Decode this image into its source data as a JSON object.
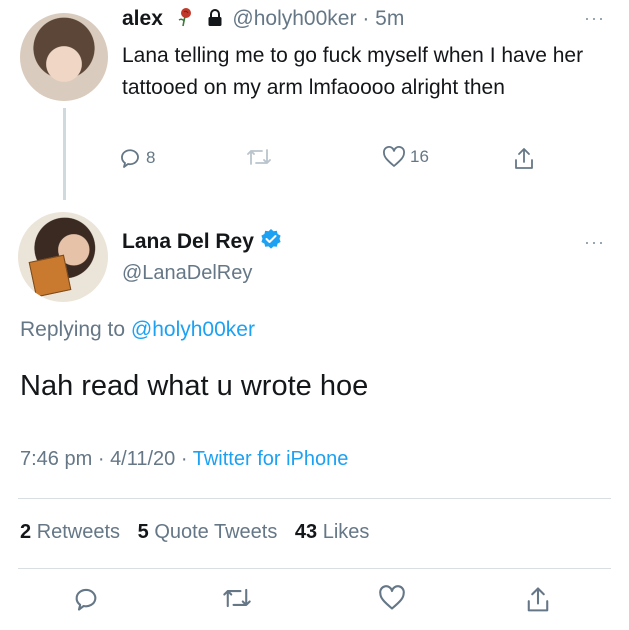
{
  "reply_tweet": {
    "name": "alex",
    "handle": "@holyh00ker",
    "separator": "·",
    "time": "5m",
    "text": "Lana telling me to go fuck myself when I have her tattooed on my arm lmfaoooo alright then",
    "reply_count": "8",
    "like_count": "16",
    "more": "···",
    "icons": [
      "rose-icon",
      "lock-icon",
      "reply-icon",
      "retweet-icon",
      "like-icon",
      "share-icon"
    ]
  },
  "main_tweet": {
    "name": "Lana Del Rey",
    "handle": "@LanaDelRey",
    "more": "···",
    "replying_label": "Replying to",
    "replying_handle": "@holyh00ker",
    "text": "Nah read what u wrote hoe",
    "time": "7:46 pm",
    "sep1": "·",
    "date": "4/11/20",
    "sep2": "·",
    "source": "Twitter for iPhone",
    "retweets_count": "2",
    "retweets_label": "Retweets",
    "quotes_count": "5",
    "quotes_label": "Quote Tweets",
    "likes_count": "43",
    "likes_label": "Likes",
    "icons": [
      "verified-badge-icon",
      "reply-icon",
      "retweet-icon",
      "like-icon",
      "share-icon"
    ]
  },
  "colors": {
    "accent": "#1da1f2",
    "secondary_text": "#657786",
    "primary_text": "#14171a",
    "divider": "#d8dee2"
  }
}
